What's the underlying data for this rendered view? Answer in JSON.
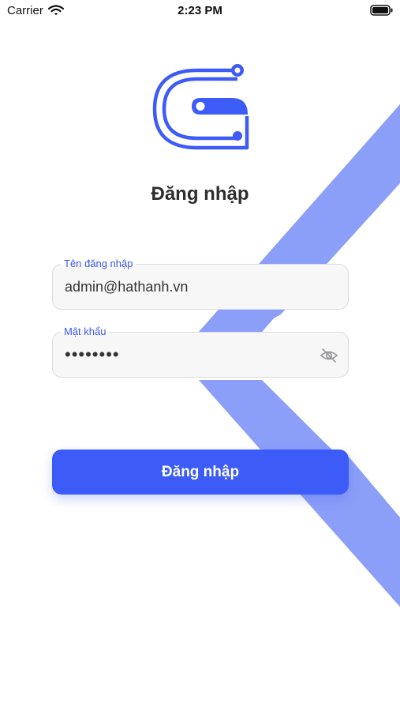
{
  "status_bar": {
    "carrier": "Carrier",
    "time": "2:23 PM"
  },
  "colors": {
    "accent": "#3c5bf7",
    "background_stripe": "#8b9ef8",
    "label": "#3d58e6"
  },
  "icons": {
    "logo": "app-logo-icon",
    "password_toggle": "eye-slash-icon",
    "wifi": "wifi-icon",
    "battery": "battery-icon"
  },
  "login": {
    "title": "Đăng nhập",
    "username": {
      "label": "Tên đăng nhập",
      "value": "admin@hathanh.vn"
    },
    "password": {
      "label": "Mật khẩu",
      "value": "••••••••"
    },
    "submit_label": "Đăng nhập"
  }
}
